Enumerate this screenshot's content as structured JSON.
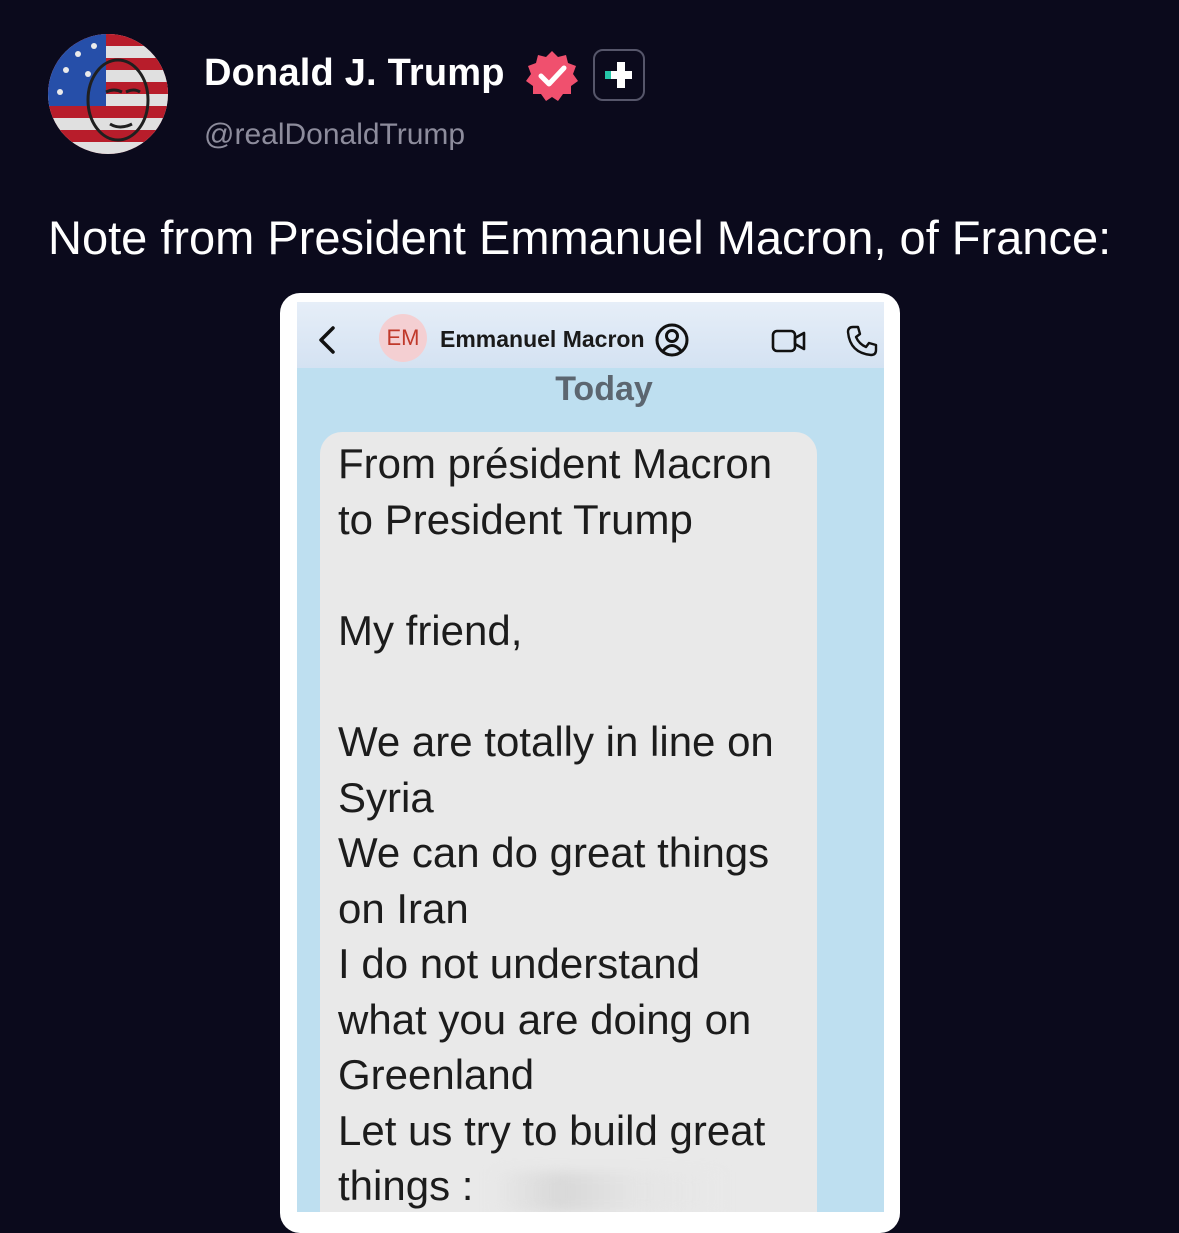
{
  "post": {
    "author_name": "Donald J. Trump",
    "handle": "@realDonaldTrump",
    "text": "Note from President Emmanuel Macron, of France:"
  },
  "icons": {
    "avatar": "profile-avatar",
    "verified": "verified-badge-icon",
    "plus": "plus-badge-icon"
  },
  "colors": {
    "background": "#0b0a1c",
    "verified_badge": "#f0506e",
    "handle": "#8d8c9c",
    "attachment_bg": "#bedff0",
    "bubble": "#e9e9e9"
  },
  "message_screenshot": {
    "contact_initials": "EM",
    "contact_name": "Emmanuel Macron",
    "date_separator": "Today",
    "message_lines": [
      "From président Macron",
      "to President Trump",
      "My friend,",
      "We are totally in line on",
      "Syria",
      "We can do great things",
      "on Iran",
      "I do not understand",
      "what you are doing on",
      "Greenland",
      "Let us try to build great",
      "things :"
    ]
  }
}
